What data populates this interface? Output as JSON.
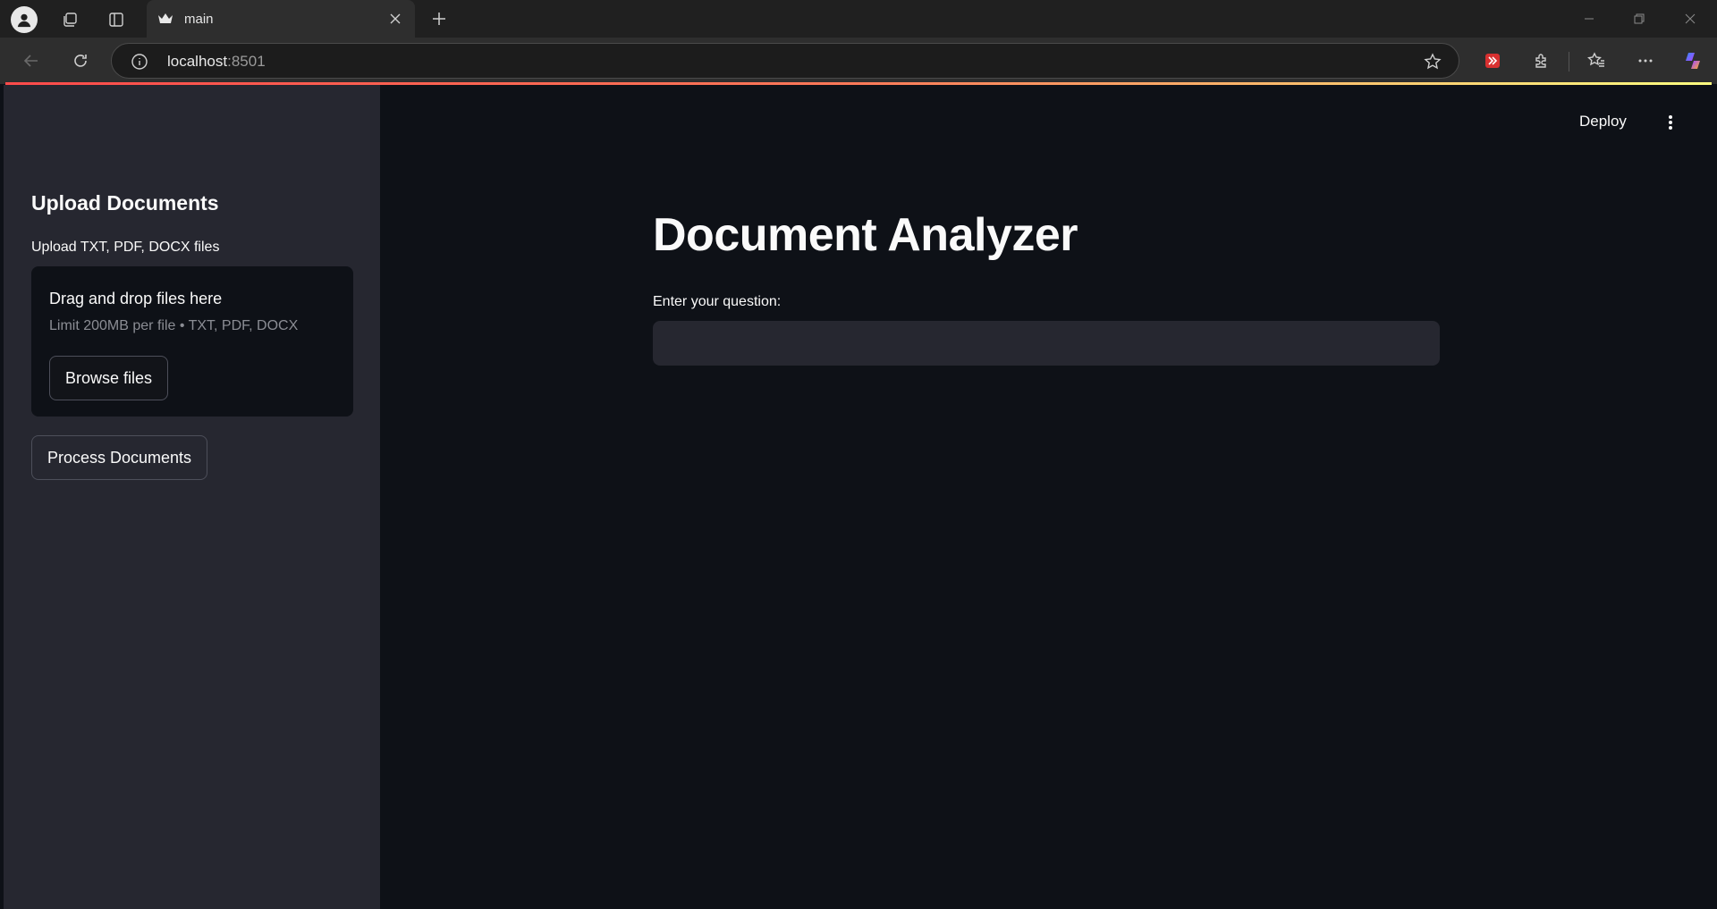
{
  "browser": {
    "tab_title": "main",
    "url_host": "localhost",
    "url_port": ":8501"
  },
  "app": {
    "deploy_label": "Deploy",
    "sidebar": {
      "heading": "Upload Documents",
      "uploader_label": "Upload TXT, PDF, DOCX files",
      "dropzone_title": "Drag and drop files here",
      "dropzone_limit": "Limit 200MB per file • TXT, PDF, DOCX",
      "browse_label": "Browse files",
      "process_label": "Process Documents"
    },
    "main": {
      "title": "Document Analyzer",
      "question_label": "Enter your question:",
      "question_value": ""
    }
  },
  "colors": {
    "accent": "#ff4b4b",
    "background": "#0e1117",
    "sidebar": "#262730",
    "text": "#fafafa"
  }
}
